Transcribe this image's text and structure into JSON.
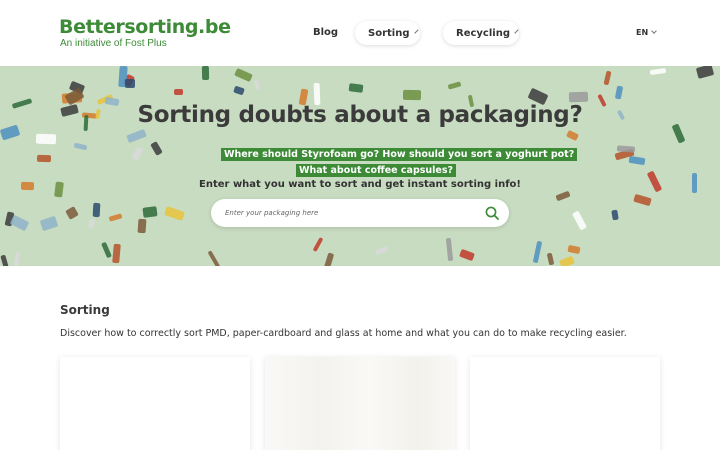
{
  "header": {
    "logo_title": "Bettersorting.be",
    "logo_subtitle": "An initiative of Fost Plus",
    "nav": {
      "blog": "Blog",
      "sorting": "Sorting",
      "recycling": "Recycling"
    },
    "language": "EN"
  },
  "hero": {
    "title": "Sorting doubts about a packaging?",
    "highlight_1": "Where should Styrofoam go? How should you sort a yoghurt pot?",
    "highlight_2": "What about coffee capsules?",
    "info": "Enter what you want to sort and get instant sorting info!",
    "search_placeholder": "Enter your packaging here",
    "search_icon": "search-icon"
  },
  "sorting_section": {
    "title": "Sorting",
    "description": "Discover how to correctly sort PMD, paper-cardboard and glass at home and what you can do to make recycling easier."
  },
  "colors": {
    "brand_green": "#3d8b37",
    "hero_background": "#c8dcc1"
  }
}
